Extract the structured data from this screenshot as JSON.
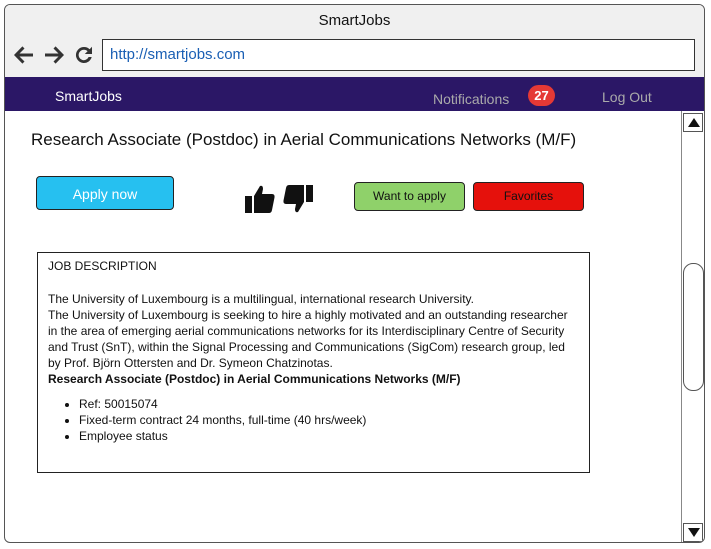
{
  "window": {
    "title": "SmartJobs"
  },
  "browser": {
    "url": "http://smartjobs.com",
    "back_icon": "arrow-left-icon",
    "forward_icon": "arrow-right-icon",
    "reload_icon": "reload-icon"
  },
  "appnav": {
    "brand": "SmartJobs",
    "notifications_label": "Notifications",
    "notifications_count": "27",
    "logout_label": "Log Out"
  },
  "job": {
    "title": "Research Associate (Postdoc) in Aerial Communications Networks (M/F)",
    "apply_label": "Apply now",
    "thumbs_up_icon": "thumbs-up-icon",
    "thumbs_down_icon": "thumbs-down-icon",
    "want_label": "Want to apply",
    "favorites_label": "Favorites",
    "description": {
      "header": "JOB DESCRIPTION",
      "paragraph1": "The University of Luxembourg is a multilingual, international research University.",
      "paragraph2": "The University of Luxembourg is seeking to hire a highly motivated and an outstanding researcher in the area of emerging aerial communications networks for its Interdisciplinary Centre of Security and Trust (SnT), within the Signal Processing and Communications (SigCom) research group, led by Prof. Björn Ottersten and Dr. Symeon Chatzinotas.",
      "bold_title": "Research Associate (Postdoc) in Aerial Communications Networks (M/F)",
      "bullets": [
        "Ref: 50015074",
        "Fixed-term contract 24 months, full-time (40 hrs/week)",
        "Employee status"
      ]
    }
  },
  "colors": {
    "nav_bg": "#2b1766",
    "apply_bg": "#26c0f0",
    "want_bg": "#8fd16a",
    "favorites_bg": "#e5110c",
    "badge_bg": "#e53935"
  }
}
